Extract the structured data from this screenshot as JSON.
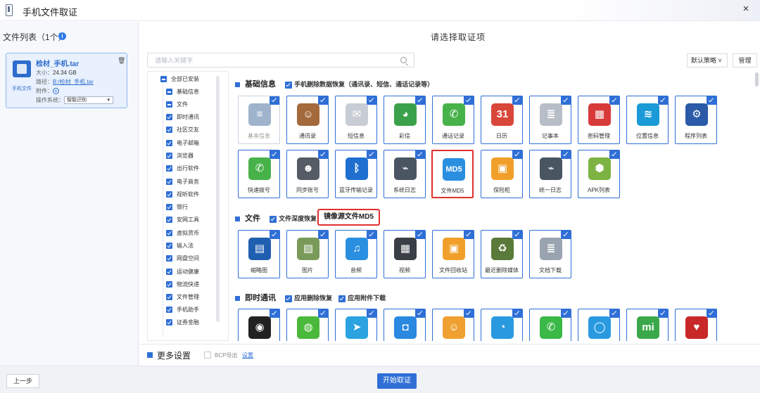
{
  "window": {
    "title": "手机文件取证",
    "close": "×"
  },
  "file_list": {
    "title": "文件列表（1个）",
    "file": {
      "name": "检材_手机.tar",
      "type_label": "手机文件",
      "size_label": "大小：",
      "size": "24.34 GB",
      "path_label": "路径：",
      "path": "B:/检材_手机.tar",
      "attach_label": "附件：",
      "attach_add": "+",
      "os_label": "操作系统：",
      "os_value": "智能识别"
    }
  },
  "main": {
    "title": "请选择取证项",
    "search_placeholder": "请输入关键字",
    "strategy": "默认策略",
    "manage": "管理",
    "mirror_label": "镜像源文件MD5"
  },
  "tree": [
    {
      "label": "全部已安装",
      "state": "minus"
    },
    {
      "label": "基础信息",
      "state": "minus"
    },
    {
      "label": "文件",
      "state": "minus"
    },
    {
      "label": "即时通讯",
      "state": "check"
    },
    {
      "label": "社区交友",
      "state": "check"
    },
    {
      "label": "电子邮箱",
      "state": "check"
    },
    {
      "label": "浏览器",
      "state": "check"
    },
    {
      "label": "出行软件",
      "state": "check"
    },
    {
      "label": "电子商务",
      "state": "check"
    },
    {
      "label": "视听软件",
      "state": "check"
    },
    {
      "label": "银行",
      "state": "check"
    },
    {
      "label": "安网工具",
      "state": "check"
    },
    {
      "label": "虚拟货币",
      "state": "check"
    },
    {
      "label": "输入法",
      "state": "check"
    },
    {
      "label": "网盘空间",
      "state": "check"
    },
    {
      "label": "运动健康",
      "state": "check"
    },
    {
      "label": "物流快递",
      "state": "check"
    },
    {
      "label": "文件管理",
      "state": "check"
    },
    {
      "label": "手机助手",
      "state": "check"
    },
    {
      "label": "证券金融",
      "state": "check"
    }
  ],
  "sections": [
    {
      "title": "基础信息",
      "subs": [
        "手机删除数据恢复（通讯录、短信、通话记录等）"
      ]
    },
    {
      "title": "文件",
      "subs": [
        "文件深度恢复"
      ]
    },
    {
      "title": "即时通讯",
      "subs": [
        "应用删除恢复",
        "应用附件下载"
      ]
    }
  ],
  "tiles_basic": [
    {
      "label": "基本信息",
      "icon": "basic-info-icon",
      "color": "#9fb4cc",
      "glyph": "≡",
      "off": true
    },
    {
      "label": "通讯录",
      "icon": "contacts-icon",
      "color": "#a46a3c",
      "glyph": "☺"
    },
    {
      "label": "短信息",
      "icon": "sms-icon",
      "color": "#c8ccd4",
      "glyph": "✉"
    },
    {
      "label": "彩信",
      "icon": "mms-icon",
      "color": "#3aa14a",
      "glyph": "◕"
    },
    {
      "label": "通话记录",
      "icon": "call-log-icon",
      "color": "#48b24a",
      "glyph": "✆"
    },
    {
      "label": "日历",
      "icon": "calendar-icon",
      "color": "#d9463a",
      "glyph": "31"
    },
    {
      "label": "记事本",
      "icon": "notepad-icon",
      "color": "#b8bec8",
      "glyph": "≣"
    },
    {
      "label": "密码管理",
      "icon": "password-icon",
      "color": "#d83a3a",
      "glyph": "▦"
    },
    {
      "label": "位置信息",
      "icon": "wifi-icon",
      "color": "#1a9ad6",
      "glyph": "≋"
    },
    {
      "label": "程序列表",
      "icon": "program-list-icon",
      "color": "#2a5aa8",
      "glyph": "⚙"
    },
    {
      "label": "快速拨号",
      "icon": "speed-dial-icon",
      "color": "#48b24a",
      "glyph": "✆"
    },
    {
      "label": "同步账号",
      "icon": "sync-account-icon",
      "color": "#555c66",
      "glyph": "☻"
    },
    {
      "label": "蓝牙传输记录",
      "icon": "bluetooth-icon",
      "color": "#1e6fd0",
      "glyph": "ᛒ"
    },
    {
      "label": "系统日志",
      "icon": "system-log-icon",
      "color": "#4a5562",
      "glyph": "⌁"
    },
    {
      "label": "文件MD5",
      "icon": "md5-icon",
      "color": "#2a8fe0",
      "glyph": "MD5",
      "hl": true
    },
    {
      "label": "保险柜",
      "icon": "safe-icon",
      "color": "#f0a02a",
      "glyph": "▣"
    },
    {
      "label": "统一日志",
      "icon": "unified-log-icon",
      "color": "#4a5562",
      "glyph": "⌁"
    },
    {
      "label": "APK列表",
      "icon": "android-icon",
      "color": "#7cb342",
      "glyph": "⬢"
    }
  ],
  "tiles_file": [
    {
      "label": "缩略图",
      "icon": "thumbnail-icon",
      "color": "#1f5fb0",
      "glyph": "▤"
    },
    {
      "label": "图片",
      "icon": "picture-icon",
      "color": "#7a9a5a",
      "glyph": "▨"
    },
    {
      "label": "音频",
      "icon": "audio-icon",
      "color": "#2a8fe0",
      "glyph": "♫"
    },
    {
      "label": "视频",
      "icon": "video-icon",
      "color": "#3a3f46",
      "glyph": "▦"
    },
    {
      "label": "文件回收站",
      "icon": "recycle-bin-icon",
      "color": "#f0a02a",
      "glyph": "▣"
    },
    {
      "label": "最近删除媒体",
      "icon": "deleted-media-icon",
      "color": "#5a7a3a",
      "glyph": "♻"
    },
    {
      "label": "文档下载",
      "icon": "document-download-icon",
      "color": "#9aa4b0",
      "glyph": "≣"
    }
  ],
  "tiles_im": [
    {
      "label": "",
      "icon": "qq-icon",
      "color": "#222222",
      "glyph": "◉"
    },
    {
      "label": "",
      "icon": "wechat-icon",
      "color": "#4ab83a",
      "glyph": "◍"
    },
    {
      "label": "",
      "icon": "telegram-icon",
      "color": "#2aa3e0",
      "glyph": "➤"
    },
    {
      "label": "",
      "icon": "chat-bubble-icon",
      "color": "#2a88e0",
      "glyph": "◘"
    },
    {
      "label": "",
      "icon": "group-chat-icon",
      "color": "#f0a030",
      "glyph": "☺"
    },
    {
      "label": "",
      "icon": "message-icon",
      "color": "#2a9ae0",
      "glyph": "◔"
    },
    {
      "label": "",
      "icon": "phone-call-icon",
      "color": "#3ab848",
      "glyph": "✆"
    },
    {
      "label": "",
      "icon": "ring-icon",
      "color": "#2a9ae0",
      "glyph": "◯"
    },
    {
      "label": "",
      "icon": "mi-talk-icon",
      "color": "#3aa84a",
      "glyph": "mi"
    },
    {
      "label": "",
      "icon": "heart-app-icon",
      "color": "#c82828",
      "glyph": "♥"
    }
  ],
  "bottom": {
    "more_settings": "更多设置",
    "bcp_label": "BCP导出",
    "bcp_link": "设置"
  },
  "footer": {
    "prev": "上一步",
    "start": "开始取证"
  }
}
